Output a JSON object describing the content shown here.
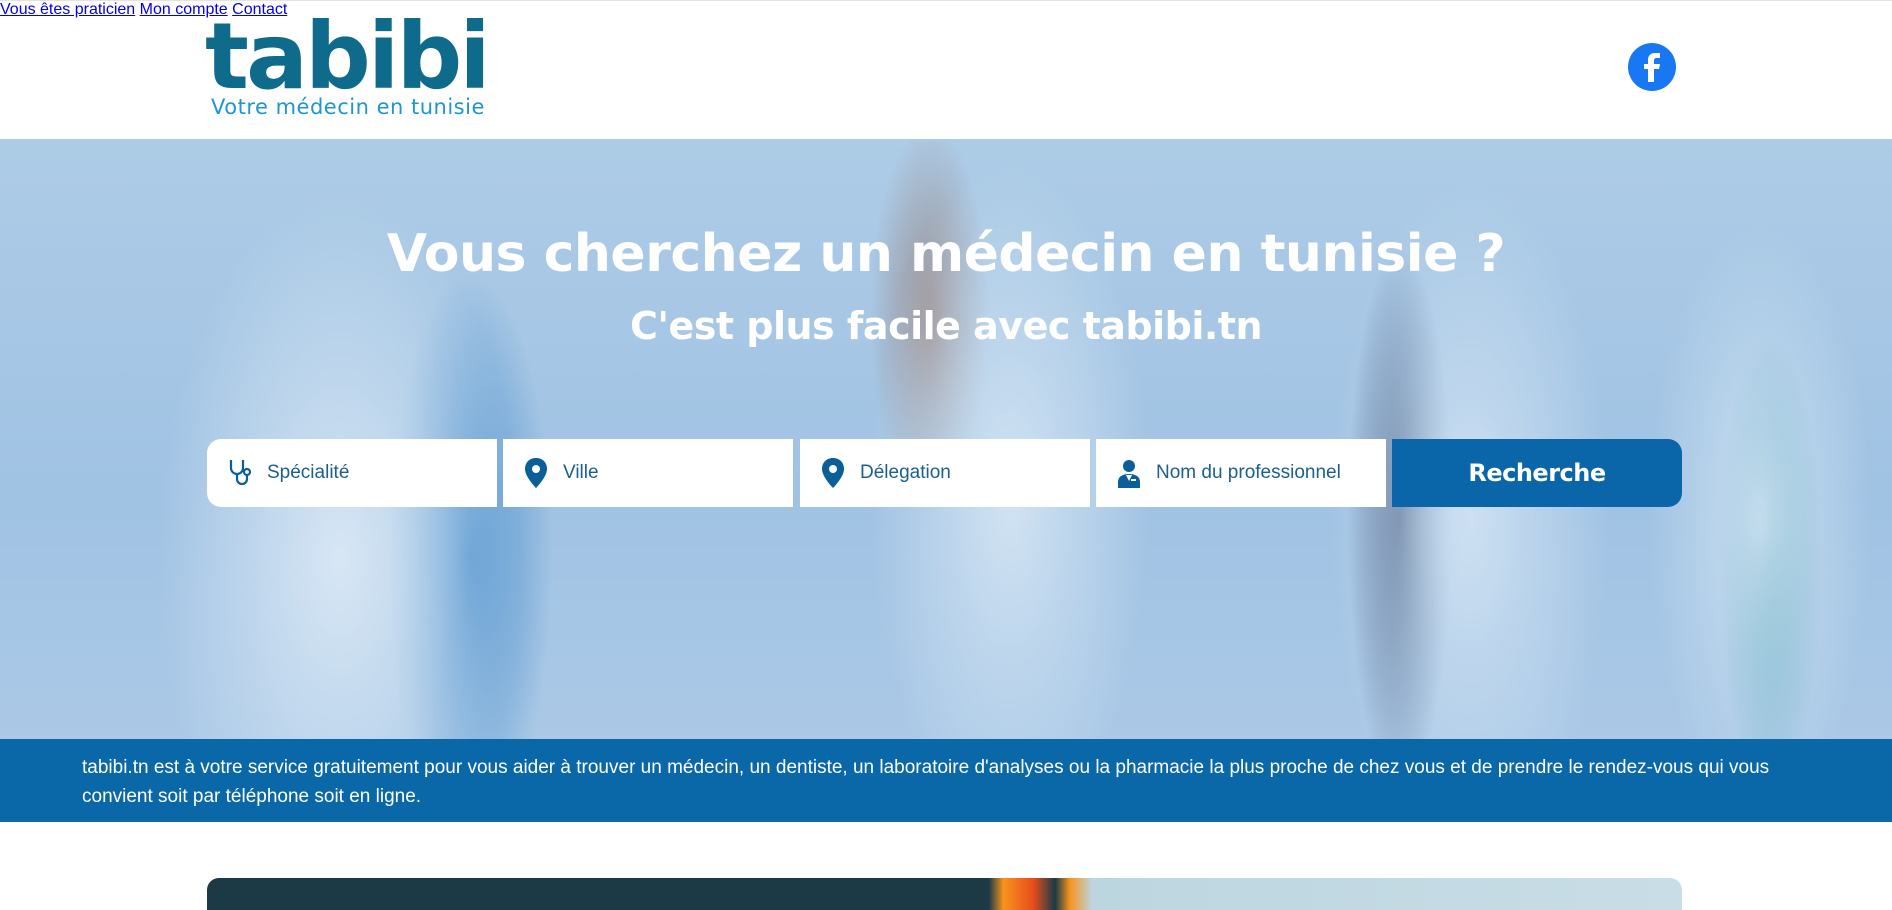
{
  "header": {
    "logo_word": "tabibi",
    "logo_tagline": "Votre médecin en tunisie",
    "nav": [
      {
        "label": "Vous êtes praticien"
      },
      {
        "label": "Mon compte"
      },
      {
        "label": "Contact"
      }
    ],
    "social_icon": "facebook-icon"
  },
  "hero": {
    "title": "Vous cherchez un médecin en tunisie ?",
    "subtitle": "C'est plus facile avec tabibi.tn",
    "search": {
      "specialite_placeholder": "Spécialité",
      "ville_placeholder": "Ville",
      "delegation_placeholder": "Délegation",
      "professionnel_placeholder": "Nom du professionnel",
      "button_label": "Recherche"
    }
  },
  "info_band": {
    "text": "tabibi.tn est à votre service gratuitement pour vous aider à trouver un médecin, un dentiste, un laboratoire d'analyses ou la pharmacie la plus proche de chez vous et de prendre le rendez-vous qui vous convient soit par téléphone soit en ligne."
  },
  "colors": {
    "brand_dark": "#0f6b8c",
    "brand_light": "#1e96d4",
    "primary_blue": "#0a66a8",
    "facebook_blue": "#1877f2"
  }
}
